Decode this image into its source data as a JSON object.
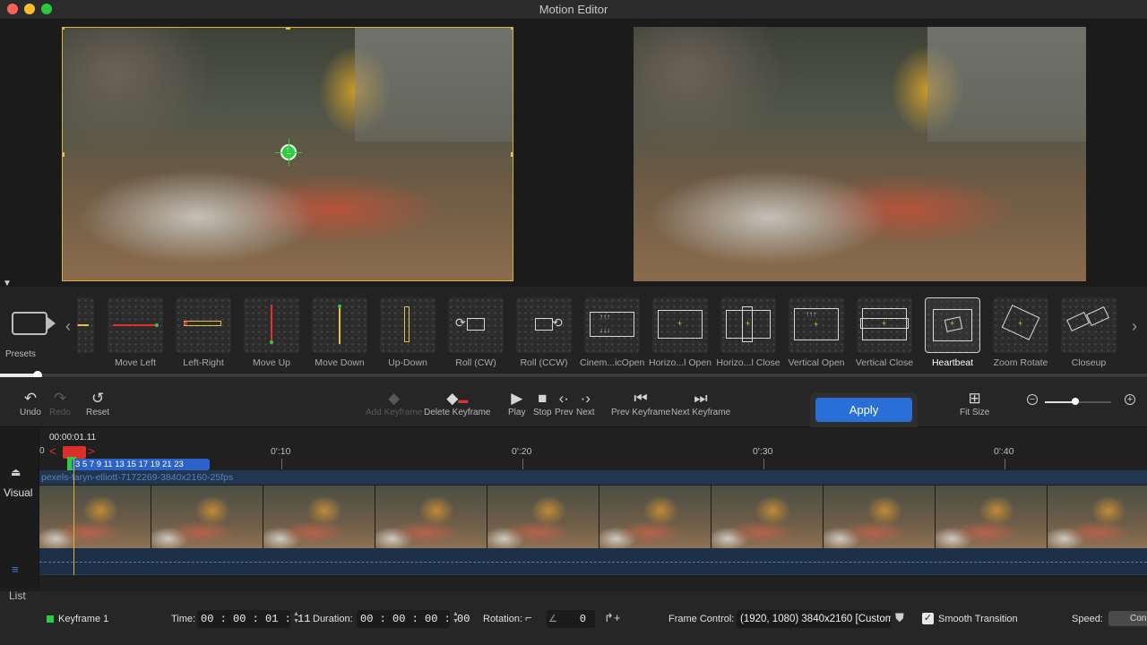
{
  "window": {
    "title": "Motion Editor"
  },
  "presets": {
    "label": "Presets",
    "items": [
      {
        "label": "ght",
        "icon": "right-motion-icon",
        "selected": false
      },
      {
        "label": "Move Left",
        "icon": "move-left-icon",
        "selected": false
      },
      {
        "label": "Left-Right",
        "icon": "left-right-icon",
        "selected": false
      },
      {
        "label": "Move Up",
        "icon": "move-up-icon",
        "selected": false
      },
      {
        "label": "Move Down",
        "icon": "move-down-icon",
        "selected": false
      },
      {
        "label": "Up-Down",
        "icon": "up-down-icon",
        "selected": false
      },
      {
        "label": "Roll (CW)",
        "icon": "roll-cw-icon",
        "selected": false
      },
      {
        "label": "Roll (CCW)",
        "icon": "roll-ccw-icon",
        "selected": false
      },
      {
        "label": "Cinem...icOpen",
        "icon": "cinematic-open-icon",
        "selected": false
      },
      {
        "label": "Horizo...l Open",
        "icon": "horizontal-open-icon",
        "selected": false
      },
      {
        "label": "Horizo...l Close",
        "icon": "horizontal-close-icon",
        "selected": false
      },
      {
        "label": "Vertical Open",
        "icon": "vertical-open-icon",
        "selected": false
      },
      {
        "label": "Vertical Close",
        "icon": "vertical-close-icon",
        "selected": false
      },
      {
        "label": "Heartbeat",
        "icon": "heartbeat-icon",
        "selected": true
      },
      {
        "label": "Zoom Rotate",
        "icon": "zoom-rotate-icon",
        "selected": false
      },
      {
        "label": "Closeup",
        "icon": "closeup-icon",
        "selected": false
      }
    ]
  },
  "toolbar": {
    "undo": "Undo",
    "redo": "Redo",
    "reset": "Reset",
    "add_keyframe": "Add Keyframe",
    "delete_keyframe": "Delete Keyframe",
    "play": "Play",
    "stop": "Stop",
    "prev": "Prev",
    "next": "Next",
    "prev_keyframe": "Prev Keyframe",
    "next_keyframe": "Next Keyframe",
    "apply": "Apply",
    "fit_size": "Fit Size"
  },
  "timeline": {
    "current_time": "00:00:01.11",
    "ticks": [
      "0",
      "0':10",
      "0':20",
      "0':30",
      "0':40"
    ],
    "keyframe_numbers": "3 5 7 9 11 13 15 17 19 21 23",
    "clip_name": "pexels-taryn-elliott-7172269-3840x2160-25fps",
    "tracks": {
      "visual": "Visual",
      "list": "List"
    }
  },
  "inspector": {
    "keyframe_name": "Keyframe 1",
    "time_label": "Time:",
    "time_value": "00 : 00 : 01 : 11",
    "duration_label": "Duration:",
    "duration_value": "00 : 00 : 00 : 00",
    "rotation_label": "Rotation:",
    "rotation_value": "0",
    "frame_control_label": "Frame Control:",
    "frame_control_value": "(1920, 1080) 3840x2160 [Custom]",
    "smooth_transition_label": "Smooth Transition",
    "smooth_transition_checked": true,
    "speed_label": "Speed:",
    "speed_value": "Con"
  },
  "colors": {
    "accent": "#2a6fd8",
    "keyframe": "#2ecc40",
    "playhead": "#d9302c",
    "crop_frame": "#d9b23a"
  }
}
